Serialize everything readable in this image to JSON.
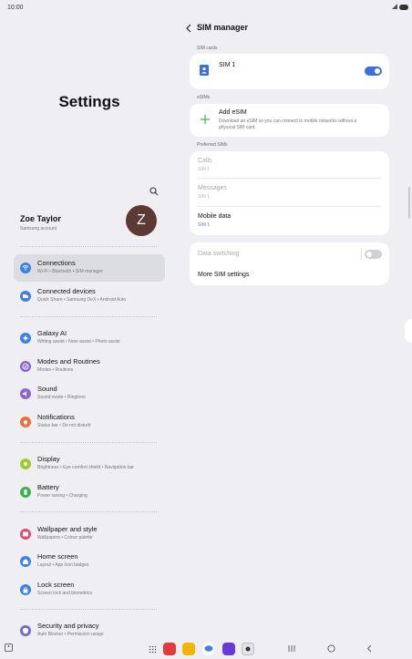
{
  "status_bar": {
    "time": "10:00"
  },
  "left": {
    "title": "Settings",
    "account": {
      "name": "Zoe Taylor",
      "subtitle": "Samsung account",
      "avatar_letter": "Z"
    },
    "items": [
      {
        "label": "Connections",
        "sub": "Wi-Fi • Bluetooth • SIM manager",
        "color": "#3f7fe8",
        "icon": "wifi-icon"
      },
      {
        "label": "Connected devices",
        "sub": "Quick Share • Samsung DeX • Android Auto",
        "color": "#3f7fe8",
        "icon": "devices-icon"
      },
      {
        "label": "Galaxy AI",
        "sub": "Writing assist • Note assist • Photo assist",
        "color": "#3f7fe8",
        "icon": "sparkle-icon"
      },
      {
        "label": "Modes and Routines",
        "sub": "Modes • Routines",
        "color": "#8a63d8",
        "icon": "check-icon"
      },
      {
        "label": "Sound",
        "sub": "Sound mode • Ringtone",
        "color": "#8a63d8",
        "icon": "speaker-icon"
      },
      {
        "label": "Notifications",
        "sub": "Status bar • Do not disturb",
        "color": "#ef6d3a",
        "icon": "bell-icon"
      },
      {
        "label": "Display",
        "sub": "Brightness • Eye comfort shield • Navigation bar",
        "color": "#9ccb2a",
        "icon": "sun-icon"
      },
      {
        "label": "Battery",
        "sub": "Power saving • Charging",
        "color": "#3bb34a",
        "icon": "battery-icon"
      },
      {
        "label": "Wallpaper and style",
        "sub": "Wallpapers • Colour palette",
        "color": "#e24a6d",
        "icon": "image-icon"
      },
      {
        "label": "Home screen",
        "sub": "Layout • App icon badges",
        "color": "#3f7fe8",
        "icon": "home-icon"
      },
      {
        "label": "Lock screen",
        "sub": "Screen lock and biometrics",
        "color": "#3f7fe8",
        "icon": "lock-icon"
      },
      {
        "label": "Security and privacy",
        "sub": "Auto Blocker • Permission usage",
        "color": "#6a6adb",
        "icon": "shield-icon"
      }
    ]
  },
  "right": {
    "header": "SIM manager",
    "sim_cards_label": "SIM cards",
    "sim1": {
      "label": "SIM 1",
      "enabled": true
    },
    "esims_label": "eSIMs",
    "add_esim": {
      "title": "Add eSIM",
      "desc_line1": "Download an eSIM so you can connect to mobile networks without a",
      "desc_line2": "physical SIM card."
    },
    "preferred_label": "Preferred SIMs",
    "preferred": [
      {
        "title": "Calls",
        "value": "SIM 1",
        "enabled": false
      },
      {
        "title": "Messages",
        "value": "SIM 1",
        "enabled": false
      },
      {
        "title": "Mobile data",
        "value": "SIM 1",
        "enabled": true
      }
    ],
    "data_switching": {
      "label": "Data switching",
      "enabled": false
    },
    "more_settings": "More SIM settings"
  },
  "colors": {
    "accent": "#3f7fe8",
    "toggle_on": "#3a6fe0",
    "toggle_off": "#d0d0d4"
  }
}
